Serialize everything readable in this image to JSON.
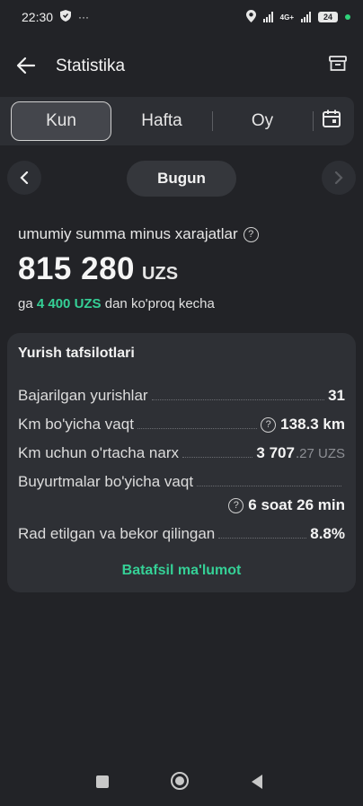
{
  "status_bar": {
    "time": "22:30",
    "network": "4G+",
    "battery": "24",
    "icons": [
      "shield-icon",
      "more-dots-icon",
      "location-icon",
      "signal-icon",
      "battery-icon"
    ]
  },
  "header": {
    "title": "Statistika",
    "back_icon": "arrow-left-icon",
    "archive_icon": "archive-icon"
  },
  "period_tabs": {
    "selected": "Kun",
    "tabs": [
      {
        "label": "Kun"
      },
      {
        "label": "Hafta"
      },
      {
        "label": "Oy"
      }
    ],
    "calendar_icon": "calendar-icon"
  },
  "date_nav": {
    "current": "Bugun",
    "prev_icon": "chevron-left-icon",
    "next_icon": "chevron-right-icon"
  },
  "summary": {
    "label": "umumiy summa minus xarajatlar",
    "amount": "815 280",
    "currency": "UZS",
    "compare_prefix": "ga",
    "compare_value": "4 400 UZS",
    "compare_suffix": "dan ko'proq kecha"
  },
  "details": {
    "title": "Yurish tafsilotlari",
    "rows": [
      {
        "label": "Bajarilgan yurishlar",
        "value": "31"
      },
      {
        "label": "Km bo'yicha vaqt",
        "value": "138.3 km"
      },
      {
        "label": "Km uchun o'rtacha narx",
        "value_main": "3 707",
        "value_frac": ".27 UZS"
      },
      {
        "label": "Buyurtmalar bo'yicha vaqt",
        "value": "6 soat 26 min"
      },
      {
        "label": "Rad etilgan va bekor qilingan",
        "value": "8.8%"
      }
    ],
    "more_link": "Batafsil ma'lumot"
  },
  "colors": {
    "background": "#222327",
    "card": "#2e3035",
    "accent_green": "#35d096"
  }
}
